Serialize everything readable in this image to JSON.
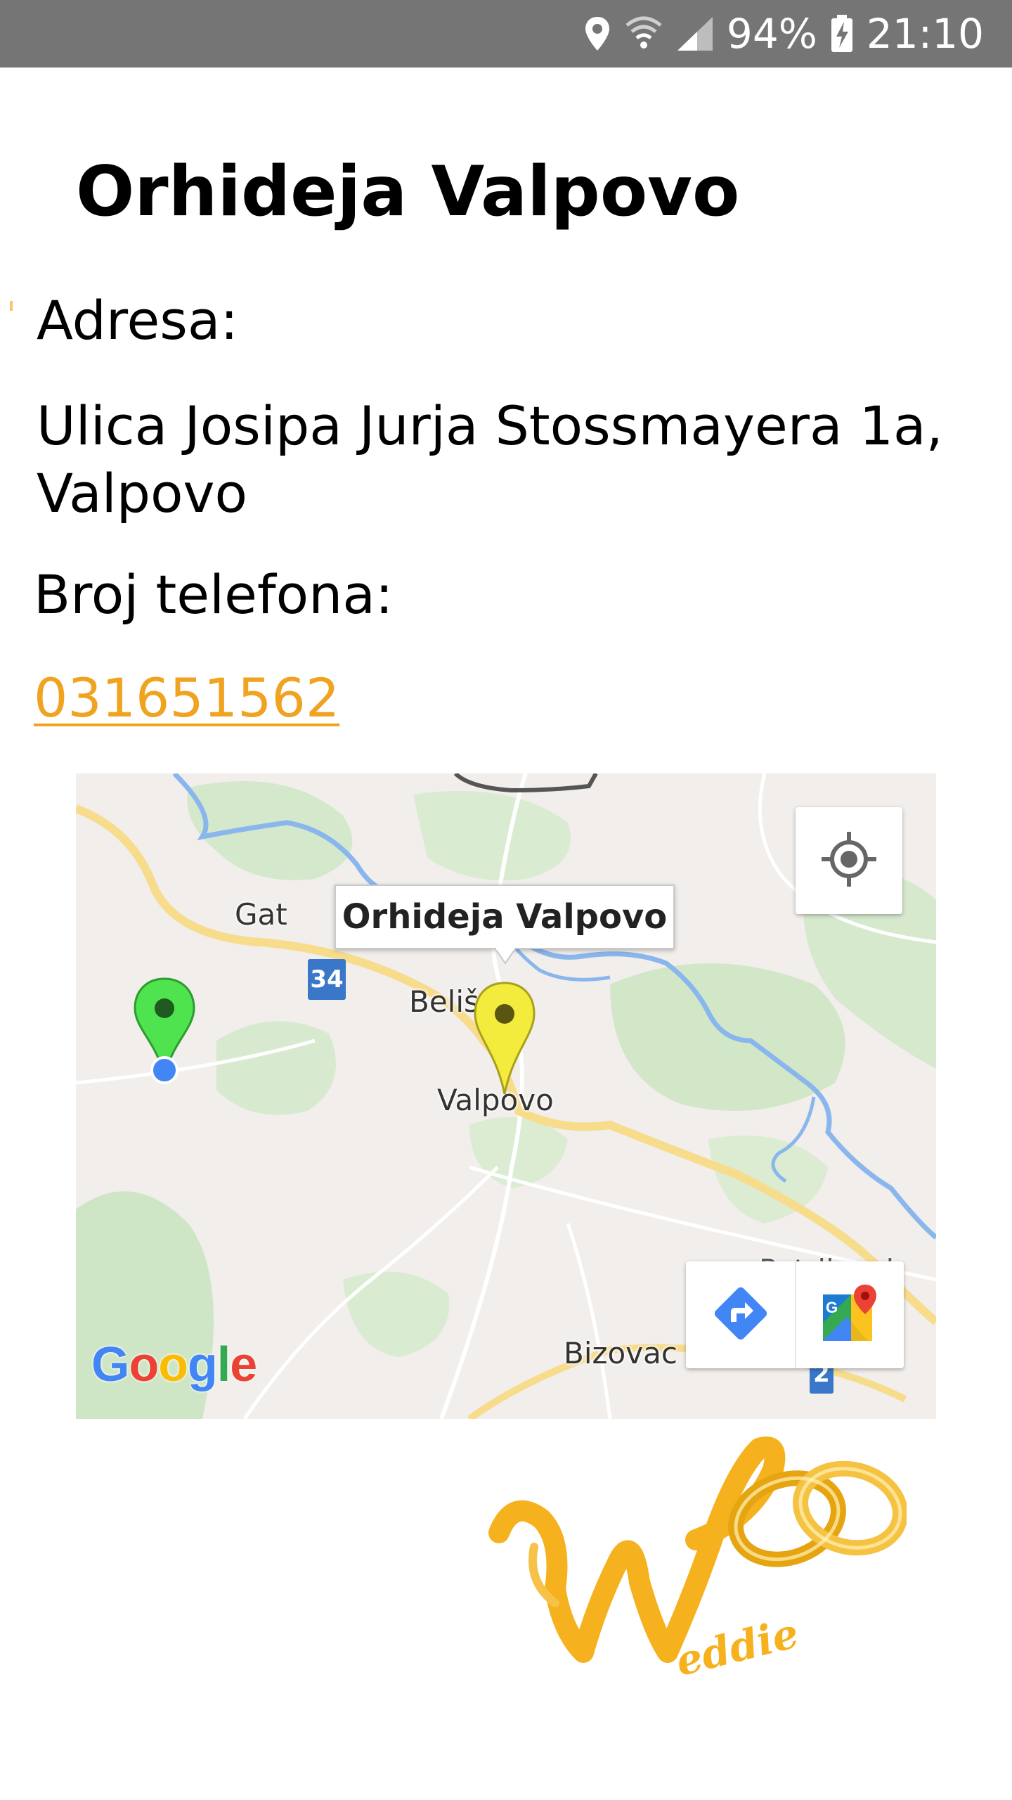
{
  "status_bar": {
    "battery": "94%",
    "time": "21:10",
    "icons": [
      "location-icon",
      "wifi-icon",
      "signal-icon",
      "battery-charging-icon"
    ]
  },
  "venue": {
    "title": "Orhideja Valpovo",
    "address_label": "Adresa:",
    "address_value": "Ulica Josipa Jurja Stossmayera 1a, Valpovo",
    "phone_label": "Broj telefona:",
    "phone_number": "031651562"
  },
  "map": {
    "marker_title": "Orhideja Valpovo",
    "places": {
      "gat": "Gat",
      "belisce": "Beliš",
      "valpovo": "Valpovo",
      "petrijevci": "Petrijevci",
      "bizovac": "Bizovac"
    },
    "road_numbers": {
      "r34": "34",
      "r2": "2"
    },
    "attribution": "Google",
    "controls": [
      "my-location-icon",
      "directions-icon",
      "google-maps-icon"
    ]
  },
  "logo": {
    "text": "Weddie"
  },
  "colors": {
    "status_bar": "#757575",
    "link": "#f0a320",
    "venue_pin": "#f4ec3c",
    "user_pin": "#4fe34f",
    "user_dot": "#4285f4",
    "logo_gold": "#f5b21e"
  }
}
